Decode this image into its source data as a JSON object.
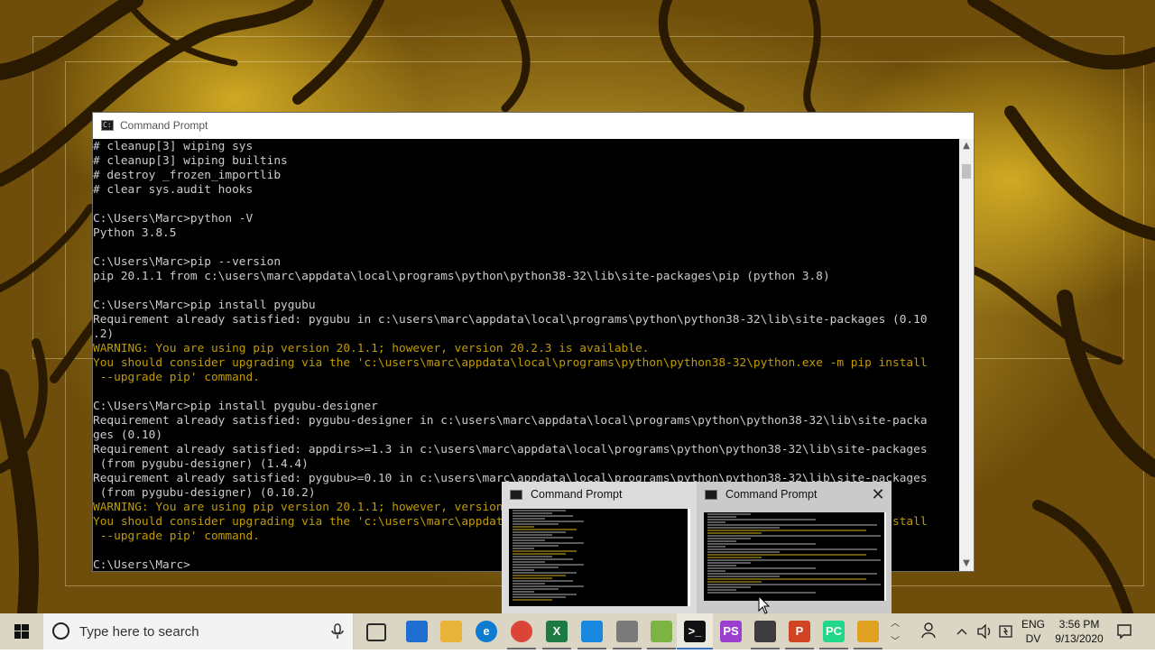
{
  "window": {
    "title": "Command Prompt"
  },
  "console": {
    "lines": [
      {
        "text": "# cleanup[3] wiping sys",
        "warn": false
      },
      {
        "text": "# cleanup[3] wiping builtins",
        "warn": false
      },
      {
        "text": "# destroy _frozen_importlib",
        "warn": false
      },
      {
        "text": "# clear sys.audit hooks",
        "warn": false
      },
      {
        "text": "",
        "warn": false
      },
      {
        "text": "C:\\Users\\Marc>python -V",
        "warn": false
      },
      {
        "text": "Python 3.8.5",
        "warn": false
      },
      {
        "text": "",
        "warn": false
      },
      {
        "text": "C:\\Users\\Marc>pip --version",
        "warn": false
      },
      {
        "text": "pip 20.1.1 from c:\\users\\marc\\appdata\\local\\programs\\python\\python38-32\\lib\\site-packages\\pip (python 3.8)",
        "warn": false
      },
      {
        "text": "",
        "warn": false
      },
      {
        "text": "C:\\Users\\Marc>pip install pygubu",
        "warn": false
      },
      {
        "text": "Requirement already satisfied: pygubu in c:\\users\\marc\\appdata\\local\\programs\\python\\python38-32\\lib\\site-packages (0.10",
        "warn": false
      },
      {
        "text": ".2)",
        "warn": false
      },
      {
        "text": "WARNING: You are using pip version 20.1.1; however, version 20.2.3 is available.",
        "warn": true
      },
      {
        "text": "You should consider upgrading via the 'c:\\users\\marc\\appdata\\local\\programs\\python\\python38-32\\python.exe -m pip install",
        "warn": true
      },
      {
        "text": " --upgrade pip' command.",
        "warn": true
      },
      {
        "text": "",
        "warn": false
      },
      {
        "text": "C:\\Users\\Marc>pip install pygubu-designer",
        "warn": false
      },
      {
        "text": "Requirement already satisfied: pygubu-designer in c:\\users\\marc\\appdata\\local\\programs\\python\\python38-32\\lib\\site-packa",
        "warn": false
      },
      {
        "text": "ges (0.10)",
        "warn": false
      },
      {
        "text": "Requirement already satisfied: appdirs>=1.3 in c:\\users\\marc\\appdata\\local\\programs\\python\\python38-32\\lib\\site-packages",
        "warn": false
      },
      {
        "text": " (from pygubu-designer) (1.4.4)",
        "warn": false
      },
      {
        "text": "Requirement already satisfied: pygubu>=0.10 in c:\\users\\marc\\appdata\\local\\programs\\python\\python38-32\\lib\\site-packages",
        "warn": false
      },
      {
        "text": " (from pygubu-designer) (0.10.2)",
        "warn": false
      },
      {
        "text": "WARNING: You are using pip version 20.1.1; however, version 20.2.3 is available.",
        "warn": true
      },
      {
        "text": "You should consider upgrading via the 'c:\\users\\marc\\appdata\\local\\programs\\python\\python38-32\\python.exe -m pip install",
        "warn": true
      },
      {
        "text": " --upgrade pip' command.",
        "warn": true
      },
      {
        "text": "",
        "warn": false
      },
      {
        "text": "C:\\Users\\Marc>",
        "warn": false
      }
    ]
  },
  "thumbnails": [
    {
      "title": "Command Prompt"
    },
    {
      "title": "Command Prompt"
    }
  ],
  "taskbar": {
    "search_placeholder": "Type here to search",
    "pinned_apps": [
      {
        "icon": "task-view-icon",
        "label": "",
        "color": "#2b2b2b"
      },
      {
        "icon": "mail-icon",
        "label": "",
        "color": "#1f6fd1"
      },
      {
        "icon": "file-explorer-icon",
        "label": "",
        "color": "#e8b53a"
      },
      {
        "icon": "edge-icon",
        "label": "e",
        "color": "#0c7bd0"
      },
      {
        "icon": "chrome-icon",
        "label": "",
        "color": "#db4437"
      },
      {
        "icon": "excel-icon",
        "label": "X",
        "color": "#1d7a43"
      },
      {
        "icon": "messaging-icon",
        "label": "",
        "color": "#1a88e0"
      },
      {
        "icon": "tools-icon",
        "label": "",
        "color": "#7a7a7a"
      },
      {
        "icon": "notepad-plus-icon",
        "label": "",
        "color": "#7cb342"
      },
      {
        "icon": "command-prompt-icon",
        "label": ">_",
        "color": "#111111"
      },
      {
        "icon": "phpstorm-icon",
        "label": "PS",
        "color": "#9b3fd1"
      },
      {
        "icon": "terminal-app-icon",
        "label": "",
        "color": "#3d3d3d"
      },
      {
        "icon": "powerpoint-icon",
        "label": "P",
        "color": "#d04423"
      },
      {
        "icon": "pycharm-icon",
        "label": "PC",
        "color": "#21d789"
      },
      {
        "icon": "git-icon",
        "label": "",
        "color": "#e0a020"
      }
    ],
    "language": "ENG",
    "keyboard": "DV",
    "time": "3:56 PM",
    "date": "9/13/2020"
  }
}
